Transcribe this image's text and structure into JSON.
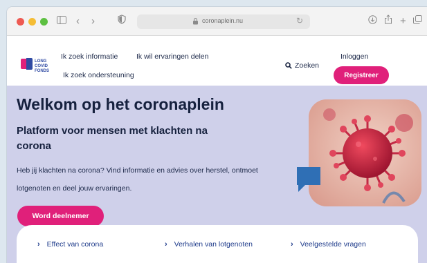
{
  "browser": {
    "url": "coronaplein.nu",
    "icons": [
      "sidebar-icon",
      "back-icon",
      "forward-icon",
      "privacy-shield-icon",
      "reload-icon",
      "download-icon",
      "share-icon",
      "new-tab-icon",
      "tabs-overview-icon"
    ]
  },
  "header": {
    "logo_text": "LONG COVID FONDS",
    "nav": {
      "info": "Ik zoek informatie",
      "share": "Ik wil ervaringen delen",
      "support": "Ik zoek ondersteuning"
    },
    "search_label": "Zoeken",
    "login_label": "Inloggen",
    "register_label": "Registreer"
  },
  "hero": {
    "title": "Welkom op het coronaplein",
    "subtitle": "Platform voor mensen met klachten na corona",
    "lead": "Heb jij klachten na corona? Vind informatie en advies over herstel, ontmoet lotgenoten en deel jouw ervaringen.",
    "cta_label": "Word deelnemer"
  },
  "quick_links": [
    {
      "label": "Effect van corona"
    },
    {
      "label": "Verhalen van lotgenoten"
    },
    {
      "label": "Veelgestelde vragen"
    }
  ],
  "colors": {
    "brand_pink": "#e0207a",
    "brand_navy": "#16213e",
    "hero_bg": "#cfd0ea",
    "link_blue": "#1d3a8a",
    "bubble_blue": "#2f6fb5"
  }
}
